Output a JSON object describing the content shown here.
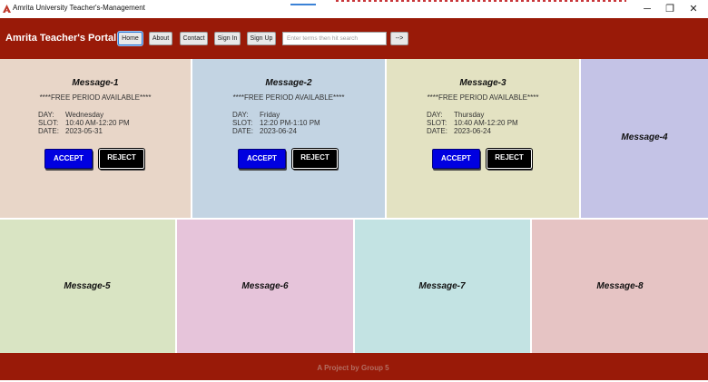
{
  "window": {
    "title": "Amrita University Teacher's-Management",
    "minimize": "─",
    "maximize": "❐",
    "close": "✕"
  },
  "header": {
    "brand": "Amrita Teacher's Portal",
    "nav": [
      "Home",
      "About",
      "Contact",
      "Sign In",
      "Sign Up"
    ],
    "search_placeholder": "Enter terms then hit search",
    "go_label": "-->"
  },
  "messages": [
    {
      "title": "Message-1",
      "announcement": "****FREE PERIOD AVAILABLE****",
      "day_label": "DAY:",
      "day": "Wednesday",
      "slot_label": "SLOT:",
      "slot": "10:40 AM-12:20 PM",
      "date_label": "DATE:",
      "date": "2023-05-31",
      "accept": "ACCEPT",
      "reject": "REJECT",
      "color": "#e8d6c8"
    },
    {
      "title": "Message-2",
      "announcement": "****FREE PERIOD AVAILABLE****",
      "day_label": "DAY:",
      "day": "Friday",
      "slot_label": "SLOT:",
      "slot": "12:20 PM-1:10 PM",
      "date_label": "DATE:",
      "date": "2023-06-24",
      "accept": "ACCEPT",
      "reject": "REJECT",
      "color": "#c3d4e3"
    },
    {
      "title": "Message-3",
      "announcement": "****FREE PERIOD AVAILABLE****",
      "day_label": "DAY:",
      "day": "Thursday",
      "slot_label": "SLOT:",
      "slot": "10:40 AM-12:20 PM",
      "date_label": "DATE:",
      "date": "2023-06-24",
      "accept": "ACCEPT",
      "reject": "REJECT",
      "color": "#e3e2c2"
    },
    {
      "title": "Message-4",
      "color": "#c4c3e6"
    },
    {
      "title": "Message-5",
      "color": "#d9e4c3"
    },
    {
      "title": "Message-6",
      "color": "#e6c4da"
    },
    {
      "title": "Message-7",
      "color": "#c3e3e3"
    },
    {
      "title": "Message-8",
      "color": "#e6c4c4"
    }
  ],
  "footer": {
    "text": "A Project by Group 5"
  },
  "colors": {
    "header": "#991a08",
    "accept": "#0000e0",
    "reject": "#000000"
  }
}
